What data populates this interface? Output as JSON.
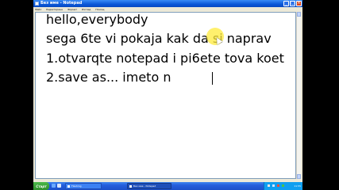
{
  "window": {
    "title": "Без име - Notepad",
    "buttons": {
      "minimize": "_",
      "maximize": "□",
      "close": "×"
    }
  },
  "menu": {
    "items": [
      "Файл",
      "Редактиране",
      "Формат",
      "Изглед",
      "Помощ"
    ]
  },
  "editor": {
    "lines": [
      "hello,everybody",
      "sega 6te vi pokaja kak da si naprav",
      "1.otvarqte notepad i pi6ete tova koet",
      "2.save as... imeto n"
    ]
  },
  "taskbar": {
    "start_label": "Старт",
    "tasks": [
      {
        "label": "Flashing"
      },
      {
        "label": "Без име - Notepad"
      }
    ],
    "clock": "11:55"
  },
  "colors": {
    "titlebar": "#0a57d8",
    "close_button": "#d9461f",
    "taskbar": "#245edb",
    "start_button": "#2f8f2c",
    "cursor_highlight": "#ffeb3c"
  },
  "icons": {
    "app": "notepad-icon",
    "quick_launch": [
      "ie-icon",
      "show-desktop-icon"
    ],
    "tray": [
      "network-icon",
      "volume-icon",
      "security-icon",
      "messenger-icon"
    ]
  }
}
